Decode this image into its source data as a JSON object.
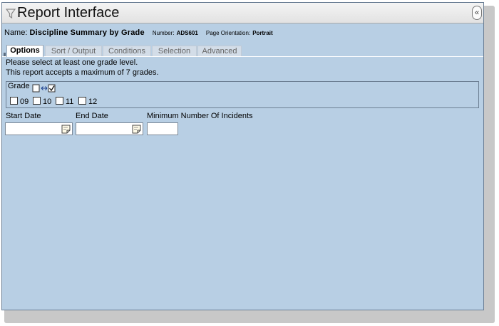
{
  "window": {
    "title": "Report Interface",
    "collapse_label": "«"
  },
  "report": {
    "name_label": "Name:",
    "name_value": "Discipline Summary by Grade",
    "number_label": "Number:",
    "number_value": "ADS601",
    "orientation_label": "Page Orientation:",
    "orientation_value": "Portrait"
  },
  "tabs": [
    {
      "label": "Options",
      "active": true
    },
    {
      "label": "Sort / Output",
      "active": false
    },
    {
      "label": "Conditions",
      "active": false
    },
    {
      "label": "Selection",
      "active": false
    },
    {
      "label": "Advanced",
      "active": false
    }
  ],
  "notices": [
    "Please select at least one grade level.",
    "This report accepts a maximum of 7 grades."
  ],
  "grade": {
    "label": "Grade",
    "toggle_icon": "select-all-toggle-icon",
    "levels": [
      {
        "label": "09",
        "checked": false
      },
      {
        "label": "10",
        "checked": false
      },
      {
        "label": "11",
        "checked": false
      },
      {
        "label": "12",
        "checked": false
      }
    ]
  },
  "fields": {
    "start_date_label": "Start Date",
    "start_date_value": "",
    "end_date_label": "End Date",
    "end_date_value": "",
    "min_incidents_label": "Minimum Number Of Incidents",
    "min_incidents_value": ""
  },
  "icons": {
    "title": "funnel-icon",
    "calendar": "calendar-icon"
  },
  "colors": {
    "panel": "#b8cfe4",
    "titlebar": "#e9e9e9",
    "border": "#6b7f95"
  }
}
